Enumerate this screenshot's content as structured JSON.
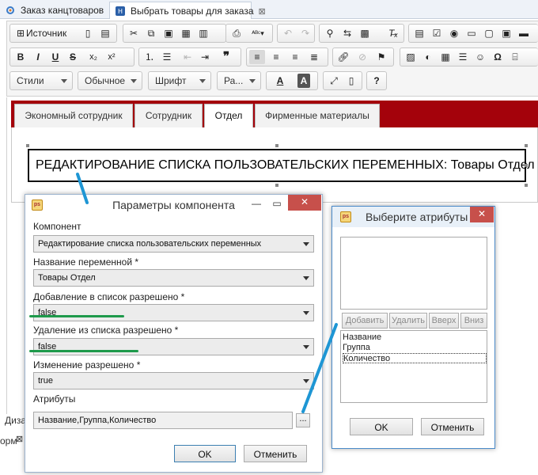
{
  "tabs": [
    {
      "label": "Заказ канцтоваров",
      "active": false
    },
    {
      "label": "Выбрать товары для заказа",
      "active": true,
      "close": "⊠"
    }
  ],
  "toolbar": {
    "source_label": "Источник",
    "styles_combo": "Стили",
    "format_combo": "Обычное",
    "font_combo": "Шрифт",
    "size_combo": "Ра...",
    "help_label": "?",
    "text_color_label": "A",
    "bg_color_label": "A"
  },
  "page_tabs": [
    {
      "label": "Экономный сотрудник",
      "active": false
    },
    {
      "label": "Сотрудник",
      "active": false
    },
    {
      "label": "Отдел",
      "active": true
    },
    {
      "label": "Фирменные материалы",
      "active": false
    }
  ],
  "heading": "РЕДАКТИРОВАНИЕ СПИСКА ПОЛЬЗОВАТЕЛЬСКИХ ПЕРЕМЕННЫХ: Товары Отдел",
  "bottom_fragments": {
    "left": "Диза",
    "bottom": "орм"
  },
  "component_dialog": {
    "title": "Параметры компонента",
    "fields": [
      {
        "label": "Компонент",
        "value": "Редактирование списка пользовательских переменных"
      },
      {
        "label": "Название переменной *",
        "value": "Товары Отдел"
      },
      {
        "label": "Добавление в список разрешено *",
        "value": "false"
      },
      {
        "label": "Удаление из списка разрешено *",
        "value": "false"
      },
      {
        "label": "Изменение разрешено *",
        "value": "true"
      }
    ],
    "attributes_label": "Атрибуты",
    "attributes_value": "Название,Группа,Количество",
    "browse_label": "...",
    "ok_label": "OK",
    "cancel_label": "Отменить"
  },
  "attr_dialog": {
    "title": "Выберите атрибуты",
    "buttons": [
      "Добавить",
      "Удалить",
      "Вверх",
      "Вниз"
    ],
    "items": [
      "Название",
      "Группа",
      "Количество"
    ],
    "focused_item": 2,
    "ok_label": "OK",
    "cancel_label": "Отменить"
  },
  "colors": {
    "accent_red": "#a4020b",
    "highlight_green": "#1e9a4b",
    "annotation_blue": "#1e96d4"
  }
}
